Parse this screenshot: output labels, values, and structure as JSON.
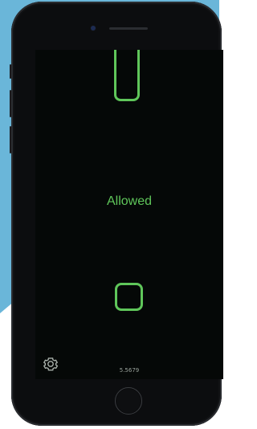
{
  "screen": {
    "status_text": "Allowed",
    "version": "5.5679"
  },
  "colors": {
    "accent": "#5fc65a",
    "background_blue": "#6ab6d9",
    "phone_body": "#0c0d0f",
    "screen_bg": "#050807"
  },
  "icons": {
    "settings": "gear-icon",
    "home": "home-button-icon"
  }
}
